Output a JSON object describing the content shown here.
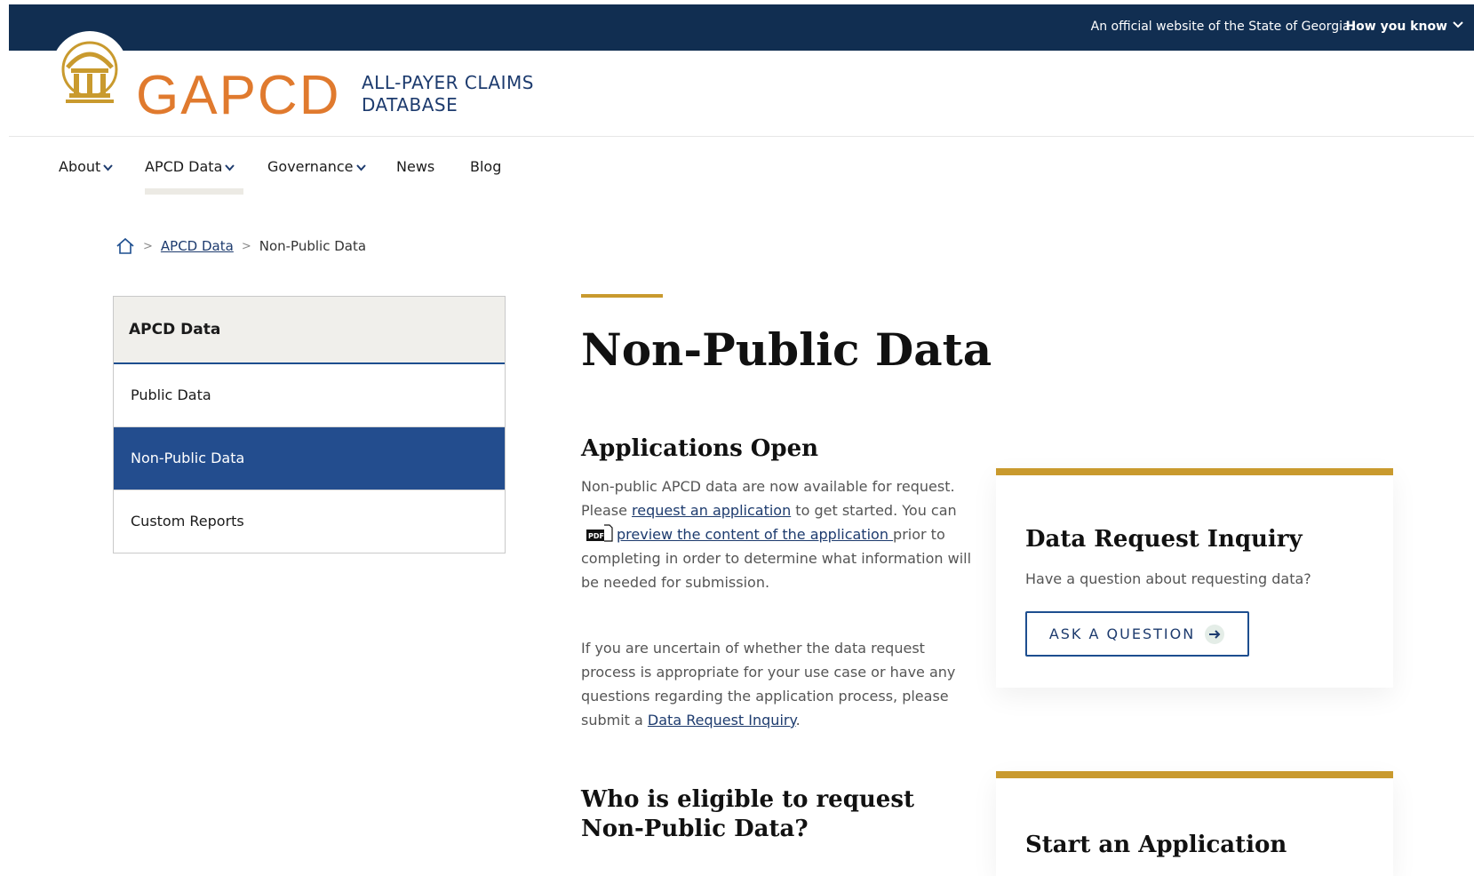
{
  "banner": {
    "official_text": "An official website of the State of Georgia.",
    "how_you_know": "How you know"
  },
  "header": {
    "logo_text": "GAPCD",
    "db_title_line1": "ALL-PAYER CLAIMS",
    "db_title_line2": "DATABASE"
  },
  "nav": {
    "items": [
      {
        "label": "About",
        "has_dropdown": true
      },
      {
        "label": "APCD Data",
        "has_dropdown": true
      },
      {
        "label": "Governance",
        "has_dropdown": true
      },
      {
        "label": "News",
        "has_dropdown": false
      },
      {
        "label": "Blog",
        "has_dropdown": false
      }
    ]
  },
  "breadcrumb": {
    "link": "APCD Data",
    "current": "Non-Public Data"
  },
  "sidebar": {
    "title": "APCD Data",
    "items": [
      {
        "label": "Public Data"
      },
      {
        "label": "Non-Public Data",
        "active": true
      },
      {
        "label": "Custom Reports"
      }
    ]
  },
  "main": {
    "title": "Non-Public Data",
    "apps_heading": "Applications Open",
    "p1_a": "Non-public APCD data are now available for request. Please ",
    "p1_link1": "request an application",
    "p1_b": " to get started.  You can ",
    "pdf_label": "PDF",
    "p1_link2": "preview the content of the application ",
    "p1_c": "prior to completing in order to determine what information will be needed for submission.",
    "p2_a": "If you are uncertain of whether the data request process is appropriate for your use case or have any questions regarding the application process, please submit a ",
    "p2_link": "Data Request Inquiry",
    "p2_b": ".",
    "who_heading": "Who is eligible to request Non-Public Data?"
  },
  "cards": {
    "inquiry": {
      "title": "Data Request Inquiry",
      "desc": "Have a question about requesting data?",
      "button": "ASK A QUESTION"
    },
    "application": {
      "title": "Start an Application"
    }
  },
  "colors": {
    "navy": "#112e51",
    "blue": "#234d8e",
    "gold": "#c99a2e",
    "orange": "#e07a2e"
  },
  "icons": {
    "home": "home-icon",
    "chevron": "chevron-down-icon",
    "pdf": "pdf-file-icon",
    "arrow": "arrow-right-circle-icon"
  }
}
